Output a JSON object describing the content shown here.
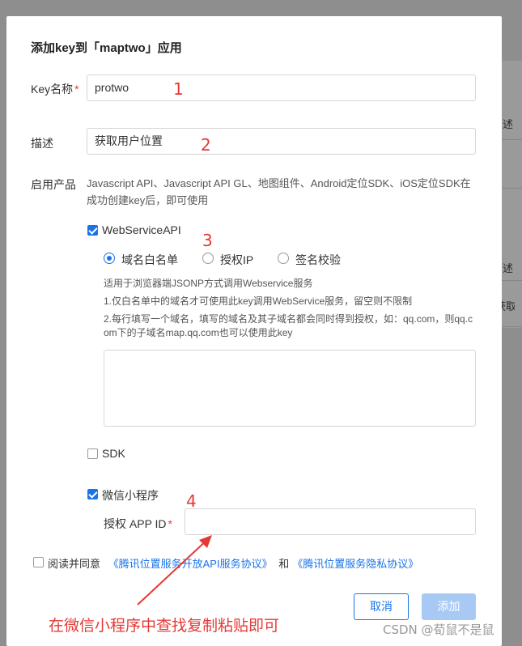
{
  "background": {
    "fragments": [
      "述",
      "述",
      "获取用"
    ]
  },
  "dialog": {
    "title": "添加key到「maptwo」应用",
    "key_name": {
      "label": "Key名称",
      "required_mark": "*",
      "value": "protwo"
    },
    "description": {
      "label": "描述",
      "value": "获取用户位置"
    },
    "products": {
      "label": "启用产品",
      "note": "Javascript API、Javascript API GL、地图组件、Android定位SDK、iOS定位SDK在成功创建key后，即可使用",
      "webservice": {
        "label": "WebServiceAPI",
        "checked": true,
        "options": [
          {
            "label": "域名白名单",
            "selected": true
          },
          {
            "label": "授权IP",
            "selected": false
          },
          {
            "label": "签名校验",
            "selected": false
          }
        ],
        "help_lines": [
          "适用于浏览器端JSONP方式调用Webservice服务",
          "1.仅白名单中的域名才可使用此key调用WebService服务，留空则不限制",
          "2.每行填写一个域名，填写的域名及其子域名都会同时得到授权，如：qq.com，则qq.c",
          "om下的子域名map.qq.com也可以使用此key"
        ],
        "textarea_value": ""
      },
      "sdk": {
        "label": "SDK",
        "checked": false
      },
      "miniprogram": {
        "label": "微信小程序",
        "checked": true,
        "appid_label": "授权 APP ID",
        "appid_required": "*",
        "appid_value": ""
      }
    },
    "agreement": {
      "checked": false,
      "prefix": "阅读并同意",
      "link1": "《腾讯位置服务开放API服务协议》",
      "conj": "和",
      "link2": "《腾讯位置服务隐私协议》"
    },
    "buttons": {
      "cancel": "取消",
      "add": "添加"
    }
  },
  "annotations": {
    "n1": "1",
    "n2": "2",
    "n3": "3",
    "n4": "4",
    "hint": "在微信小程序中查找复制粘贴即可",
    "color": "#e53935"
  },
  "watermark": "CSDN @荀鼠不是鼠",
  "colors": {
    "accent": "#1a73e8",
    "required": "#e53935"
  }
}
